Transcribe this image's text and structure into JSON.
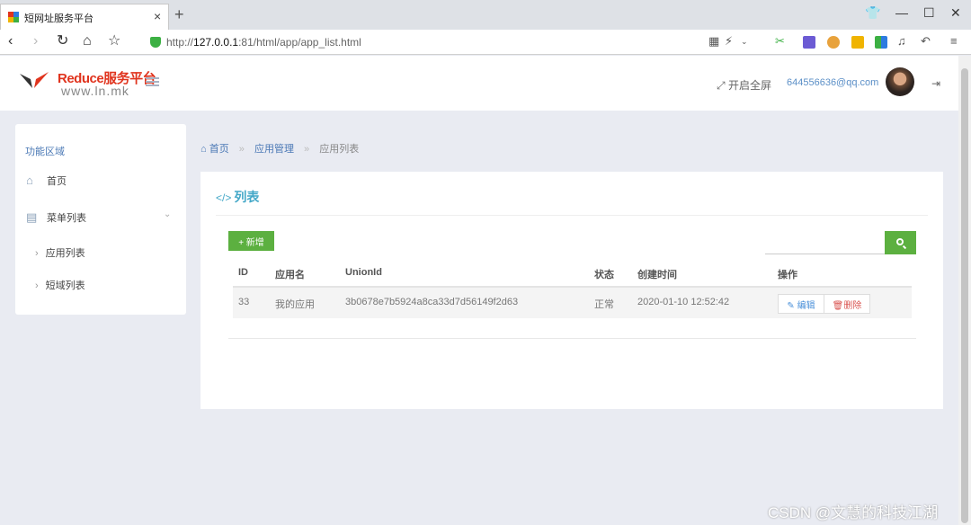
{
  "browser": {
    "tab_title": "短网址服务平台",
    "url_scheme": "http://",
    "url_host": "127.0.0.1",
    "url_path": ":81/html/app/app_list.html"
  },
  "header": {
    "logo_text": "Reduce服务平台",
    "logo_sub": "www.ln.mk",
    "fullscreen_label": "开启全屏",
    "user_email": "644556636@qq.com"
  },
  "sidebar": {
    "section_title": "功能区域",
    "items": [
      {
        "label": "首页"
      },
      {
        "label": "菜单列表"
      }
    ],
    "subitems": [
      {
        "label": "应用列表"
      },
      {
        "label": "短域列表"
      }
    ]
  },
  "breadcrumb": {
    "home": "首页",
    "level1": "应用管理",
    "current": "应用列表",
    "sep": "»"
  },
  "panel": {
    "title": "列表",
    "add_button": "+ 新增",
    "search_placeholder": ""
  },
  "table": {
    "columns": [
      "ID",
      "应用名",
      "UnionId",
      "状态",
      "创建时间",
      "操作"
    ],
    "rows": [
      {
        "id": "33",
        "name": "我的应用",
        "union_id": "3b0678e7b5924a8ca33d7d56149f2d63",
        "status": "正常",
        "created": "2020-01-10 12:52:42",
        "edit_label": "编辑",
        "delete_label": "删除"
      }
    ]
  },
  "watermark": "CSDN @文慧的科技江湖",
  "colors": {
    "accent_green": "#5cb040",
    "link_blue": "#4a78b5",
    "title_teal": "#44a8c8",
    "delete_red": "#d9534f"
  }
}
